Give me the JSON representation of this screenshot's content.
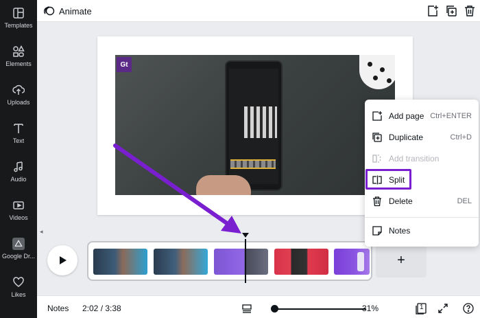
{
  "sidebar": {
    "items": [
      {
        "label": "Templates",
        "icon": "templates-icon"
      },
      {
        "label": "Elements",
        "icon": "elements-icon"
      },
      {
        "label": "Uploads",
        "icon": "uploads-icon"
      },
      {
        "label": "Text",
        "icon": "text-icon"
      },
      {
        "label": "Audio",
        "icon": "audio-icon"
      },
      {
        "label": "Videos",
        "icon": "videos-icon"
      },
      {
        "label": "Google Dr...",
        "icon": "google-drive-icon"
      },
      {
        "label": "Likes",
        "icon": "heart-icon"
      }
    ]
  },
  "header": {
    "animate_label": "Animate"
  },
  "canvas": {
    "logo_text": "Gt"
  },
  "context_menu": {
    "items": [
      {
        "label": "Add page",
        "shortcut": "Ctrl+ENTER",
        "icon": "add-page-icon",
        "disabled": false
      },
      {
        "label": "Duplicate",
        "shortcut": "Ctrl+D",
        "icon": "duplicate-icon",
        "disabled": false
      },
      {
        "label": "Add transition",
        "shortcut": "",
        "icon": "transition-icon",
        "disabled": true
      },
      {
        "label": "Split",
        "shortcut": "",
        "icon": "split-icon",
        "disabled": false
      },
      {
        "label": "Delete",
        "shortcut": "DEL",
        "icon": "trash-icon",
        "disabled": false
      },
      {
        "label": "Notes",
        "shortcut": "",
        "icon": "notes-icon",
        "disabled": false
      }
    ]
  },
  "timeline": {
    "add_label": "+",
    "clips": [
      "clip-1",
      "clip-2",
      "clip-3",
      "clip-4",
      "clip-5"
    ]
  },
  "footer": {
    "notes_label": "Notes",
    "time": "2:02 / 3:38",
    "zoom": "31%",
    "page_count": "1"
  },
  "colors": {
    "sidebar_bg": "#18191b",
    "highlight": "#7a1fd0",
    "arrow": "#7a1fd0"
  }
}
